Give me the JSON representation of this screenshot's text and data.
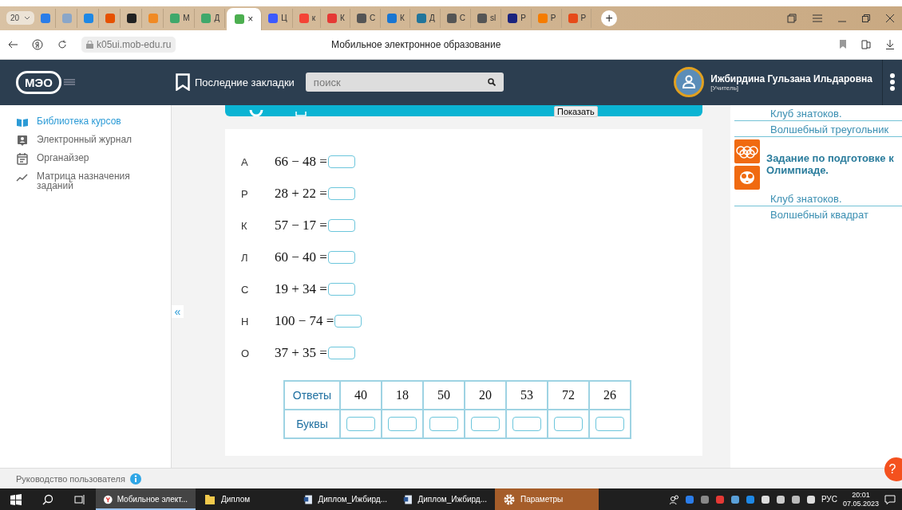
{
  "browser": {
    "tab_counter": "20",
    "tabs": [
      {
        "color": "#2b7de9",
        "selected": false
      },
      {
        "color": "#8aa6c8",
        "selected": false
      },
      {
        "color": "#1e88e5",
        "selected": false
      },
      {
        "color": "#e65100",
        "selected": false
      },
      {
        "color": "#222222",
        "selected": false
      },
      {
        "color": "#f08a24",
        "selected": false
      },
      {
        "label": "М",
        "color": "#3fa86b",
        "selected": false
      },
      {
        "label": "Д",
        "color": "#3fa86b",
        "selected": false
      },
      {
        "label": "×",
        "color": "#4caf50",
        "selected": true
      },
      {
        "label": "Ц",
        "color": "#3d5afe",
        "selected": false
      },
      {
        "label": "к",
        "color": "#f44336",
        "selected": false
      },
      {
        "label": "К",
        "color": "#e53935",
        "selected": false
      },
      {
        "label": "С",
        "color": "#555555",
        "selected": false
      },
      {
        "label": "К",
        "color": "#1976d2",
        "selected": false
      },
      {
        "label": "Д",
        "color": "#21759b",
        "selected": false
      },
      {
        "label": "С",
        "color": "#555555",
        "selected": false
      },
      {
        "label": "sl",
        "color": "#555555",
        "selected": false
      },
      {
        "label": "Р",
        "color": "#1a237e",
        "selected": false
      },
      {
        "label": "Р",
        "color": "#f57c00",
        "selected": false
      },
      {
        "label": "Р",
        "color": "#e64a19",
        "selected": false
      }
    ],
    "new_tab": "+",
    "address": "k05ui.mob-edu.ru",
    "page_title": "Мобильное электронное образование"
  },
  "header": {
    "logo": "МЭО",
    "bookmarks": "Последние закладки",
    "search": {
      "placeholder": "поиск"
    },
    "user_name": "Ижбирдина Гульзана Ильдаровна",
    "user_role": "[Учитель]"
  },
  "sidebar": {
    "items": [
      {
        "label": "Библиотека курсов",
        "selected": true
      },
      {
        "label": "Электронный журнал",
        "selected": false
      },
      {
        "label": "Органайзер",
        "selected": false
      },
      {
        "label": "Матрица назначения заданий",
        "selected": false
      }
    ],
    "collapse": "«"
  },
  "toolbar": {
    "show_button": "Показать"
  },
  "exercise": {
    "rows": [
      {
        "letter": "А",
        "expression": "66 − 48 ="
      },
      {
        "letter": "Р",
        "expression": "28 + 22 ="
      },
      {
        "letter": "К",
        "expression": "57 − 17 ="
      },
      {
        "letter": "Л",
        "expression": "60 − 40 ="
      },
      {
        "letter": "С",
        "expression": "19 + 34 ="
      },
      {
        "letter": "Н",
        "expression": "100 − 74 ="
      },
      {
        "letter": "О",
        "expression": "37 + 35 ="
      }
    ],
    "table": {
      "answers_label": "Ответы",
      "answers": [
        "40",
        "18",
        "50",
        "20",
        "53",
        "72",
        "26"
      ],
      "letters_label": "Буквы"
    }
  },
  "right_panel": {
    "items": [
      {
        "kind": "link",
        "text": "Клуб знатоков."
      },
      {
        "kind": "link",
        "text": "Волшебный треугольник"
      },
      {
        "kind": "heading",
        "text": "Задание по подготовке к Олимпиаде."
      },
      {
        "kind": "link",
        "text": "Клуб знатоков."
      },
      {
        "kind": "link",
        "text": "Волшебный квадрат"
      }
    ]
  },
  "footer": {
    "guide": "Руководство пользователя",
    "help": "?"
  },
  "taskbar": {
    "apps": [
      {
        "label": "Мобильное элект...",
        "kind": "browser",
        "selected": true,
        "attention": false
      },
      {
        "label": "Диплом",
        "kind": "folder",
        "selected": false,
        "attention": false
      },
      {
        "label": "Диплом_Ижбирд...",
        "kind": "document",
        "selected": false,
        "attention": false
      },
      {
        "label": "Диплом_Ижбирд...",
        "kind": "document",
        "selected": false,
        "attention": false
      },
      {
        "label": "Параметры",
        "kind": "settings",
        "selected": false,
        "attention": true
      }
    ],
    "language": "РУС",
    "time": "20:01",
    "date": "07.05.2023"
  }
}
